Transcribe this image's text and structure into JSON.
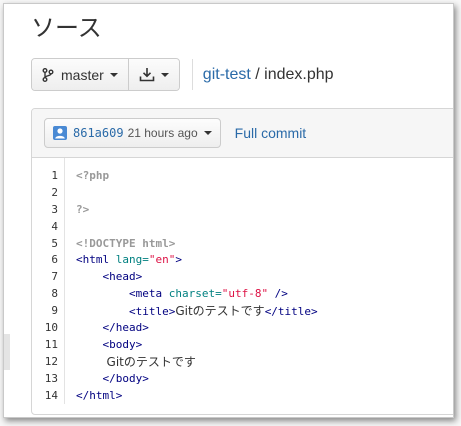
{
  "page": {
    "title": "ソース"
  },
  "toolbar": {
    "branch_label": "master",
    "repo_name": "git-test",
    "separator": " / ",
    "file_name": "index.php"
  },
  "commit": {
    "sha": "861a609",
    "time_ago": "21 hours ago",
    "full_commit_label": "Full commit"
  },
  "code": {
    "line_numbers": [
      "1",
      "2",
      "3",
      "4",
      "5",
      "6",
      "7",
      "8",
      "9",
      "10",
      "11",
      "12",
      "13",
      "14"
    ],
    "lines": [
      [
        {
          "t": "<?php",
          "k": "meta"
        }
      ],
      [],
      [
        {
          "t": "?>",
          "k": "meta"
        }
      ],
      [],
      [
        {
          "t": "<!DOCTYPE html>",
          "k": "meta"
        }
      ],
      [
        {
          "t": "<html ",
          "k": "tag"
        },
        {
          "t": "lang=",
          "k": "attr"
        },
        {
          "t": "\"en\"",
          "k": "str"
        },
        {
          "t": ">",
          "k": "tag"
        }
      ],
      [
        {
          "t": "    <head>",
          "k": "tag"
        }
      ],
      [
        {
          "t": "        <meta ",
          "k": "tag"
        },
        {
          "t": "charset=",
          "k": "attr"
        },
        {
          "t": "\"utf-8\"",
          "k": "str"
        },
        {
          "t": " />",
          "k": "tag"
        }
      ],
      [
        {
          "t": "        <title>",
          "k": "tag"
        },
        {
          "t": "Gitのテストです",
          "k": "text"
        },
        {
          "t": "</title>",
          "k": "tag"
        }
      ],
      [
        {
          "t": "    </head>",
          "k": "tag"
        }
      ],
      [
        {
          "t": "    <body>",
          "k": "tag"
        }
      ],
      [
        {
          "t": "        ",
          "k": "text"
        },
        {
          "t": "Gitのテストです",
          "k": "text"
        }
      ],
      [
        {
          "t": "    </body>",
          "k": "tag"
        }
      ],
      [
        {
          "t": "</html>",
          "k": "tag"
        }
      ]
    ]
  }
}
